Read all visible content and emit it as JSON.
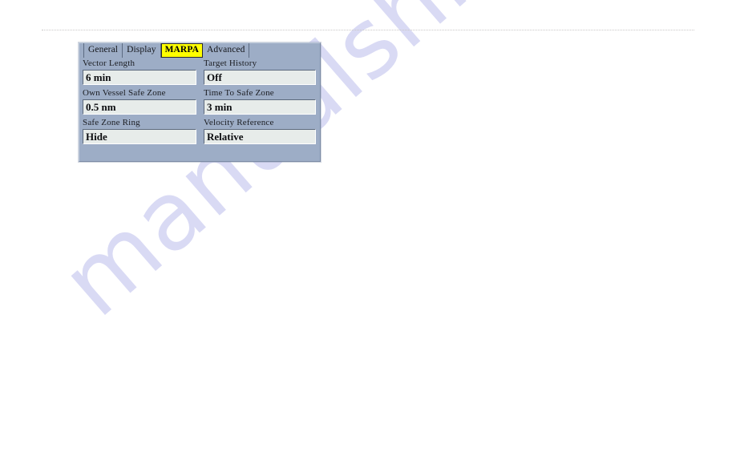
{
  "page": {
    "watermark_text": "manualshive.com",
    "watermark_color": "#d8d9f4",
    "background_color": "#ffffff"
  },
  "dialog": {
    "name": "marpa-settings-dialog",
    "background_color": "#9dadc6",
    "tabs": [
      {
        "label": "General",
        "active": false
      },
      {
        "label": "Display",
        "active": false
      },
      {
        "label": "MARPA",
        "active": true
      },
      {
        "label": "Advanced",
        "active": false
      }
    ],
    "active_tab": "MARPA",
    "active_tab_color": "#ffff00",
    "rows": [
      {
        "left": {
          "label": "Vector Length",
          "value": "6 min"
        },
        "right": {
          "label": "Target History",
          "value": "Off"
        }
      },
      {
        "left": {
          "label": "Own Vessel Safe Zone",
          "value": "0.5 nm"
        },
        "right": {
          "label": "Time To Safe Zone",
          "value": "3 min"
        }
      },
      {
        "left": {
          "label": "Safe Zone Ring",
          "value": "Hide"
        },
        "right": {
          "label": "Velocity Reference",
          "value": "Relative"
        }
      }
    ]
  }
}
